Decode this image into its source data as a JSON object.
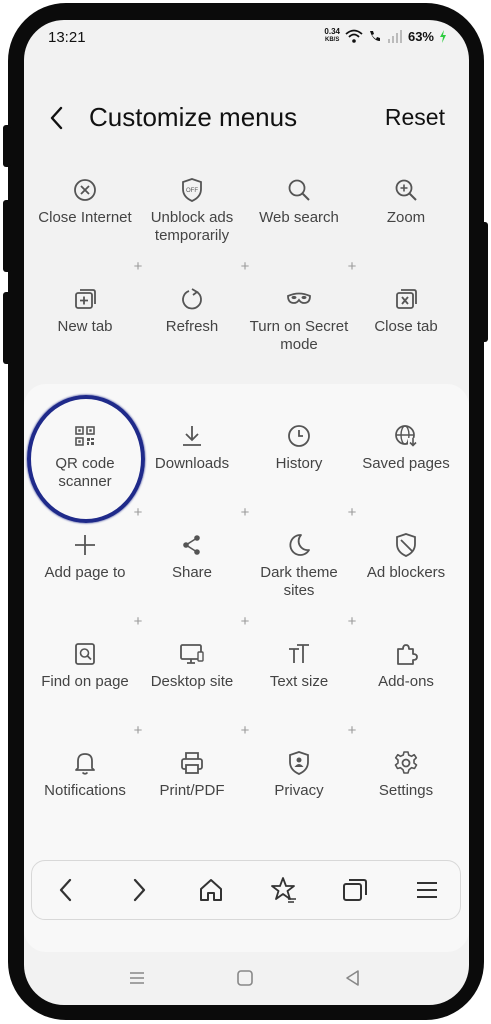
{
  "status_bar": {
    "time": "13:21",
    "speed_value": "0.34",
    "speed_unit": "KB/S",
    "battery": "63%"
  },
  "header": {
    "title": "Customize menus",
    "reset_label": "Reset"
  },
  "top_items": [
    {
      "label": "Close Internet",
      "icon": "close-circle-icon"
    },
    {
      "label": "Unblock ads temporarily",
      "icon": "ads-off-shield-icon"
    },
    {
      "label": "Web search",
      "icon": "search-icon"
    },
    {
      "label": "Zoom",
      "icon": "zoom-in-icon"
    },
    {
      "label": "New tab",
      "icon": "new-tab-icon"
    },
    {
      "label": "Refresh",
      "icon": "refresh-icon"
    },
    {
      "label": "Turn on Secret mode",
      "icon": "secret-mode-mask-icon"
    },
    {
      "label": "Close tab",
      "icon": "close-tab-icon"
    }
  ],
  "panel_items": [
    {
      "label": "QR code scanner",
      "icon": "qr-code-icon"
    },
    {
      "label": "Downloads",
      "icon": "download-icon"
    },
    {
      "label": "History",
      "icon": "clock-icon"
    },
    {
      "label": "Saved pages",
      "icon": "globe-download-icon"
    },
    {
      "label": "Add page to",
      "icon": "plus-icon"
    },
    {
      "label": "Share",
      "icon": "share-icon"
    },
    {
      "label": "Dark theme sites",
      "icon": "moon-icon"
    },
    {
      "label": "Ad blockers",
      "icon": "ad-block-shield-icon"
    },
    {
      "label": "Find on page",
      "icon": "find-on-page-icon"
    },
    {
      "label": "Desktop site",
      "icon": "desktop-icon"
    },
    {
      "label": "Text size",
      "icon": "text-size-icon"
    },
    {
      "label": "Add-ons",
      "icon": "puzzle-icon"
    },
    {
      "label": "Notifications",
      "icon": "bell-icon"
    },
    {
      "label": "Print/PDF",
      "icon": "printer-icon"
    },
    {
      "label": "Privacy",
      "icon": "privacy-shield-icon"
    },
    {
      "label": "Settings",
      "icon": "gear-icon"
    }
  ],
  "plus_symbol": "+",
  "bottom_nav": [
    "back-arrow-icon",
    "forward-arrow-icon",
    "home-icon",
    "bookmark-star-icon",
    "tabs-icon",
    "menu-icon"
  ],
  "system_nav": [
    "recents-icon",
    "home-square-icon",
    "back-triangle-icon"
  ],
  "colors": {
    "highlight_ring": "#1f2a8a",
    "battery_charge": "#2ecc40"
  }
}
